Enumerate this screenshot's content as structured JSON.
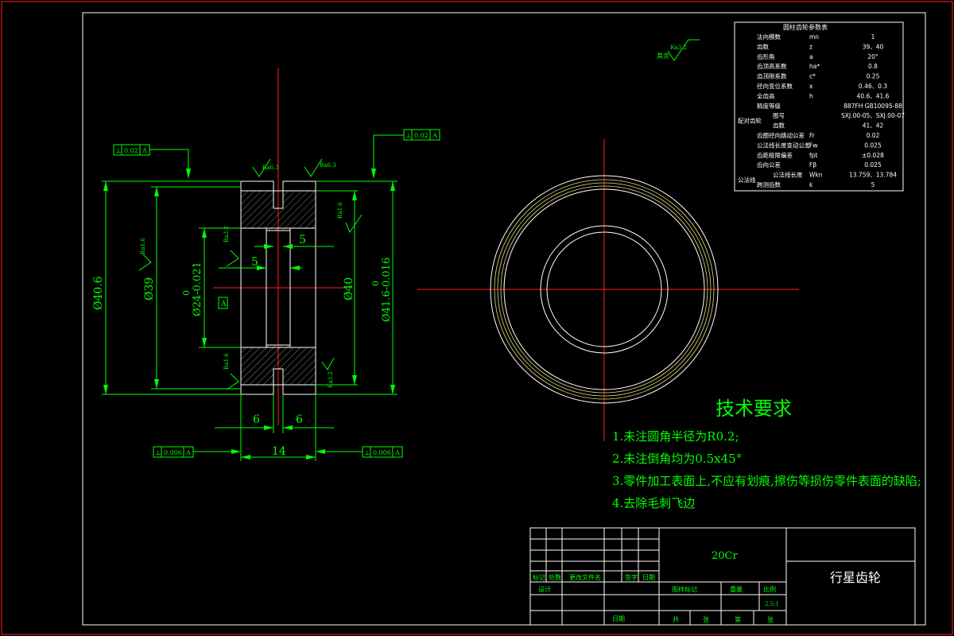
{
  "gear_params": {
    "title": "圆柱齿轮参数表",
    "rows": [
      {
        "name": "法向模数",
        "sym": "mn",
        "val": "1"
      },
      {
        "name": "齿数",
        "sym": "z",
        "val": "39、40"
      },
      {
        "name": "齿形角",
        "sym": "a",
        "val": "20°"
      },
      {
        "name": "齿顶高系数",
        "sym": "ha*",
        "val": "0.8"
      },
      {
        "name": "齿顶隙系数",
        "sym": "c*",
        "val": "0.25"
      },
      {
        "name": "径向变位系数",
        "sym": "x",
        "val": "0.46、0.3"
      },
      {
        "name": "全齿高",
        "sym": "h",
        "val": "40.6、41.6"
      },
      {
        "name": "精度等级",
        "sym": "",
        "val": "887FH GB10095-88"
      },
      {
        "name": "图号",
        "sym": "",
        "val": "SXJ.00-05、SXJ.00-07"
      },
      {
        "name": "齿数",
        "sym": "",
        "val": "41、42"
      },
      {
        "name": "齿圈径向跳动公差",
        "sym": "Fr",
        "val": "0.02"
      },
      {
        "name": "公法线长度变动公差",
        "sym": "Fw",
        "val": "0.025"
      },
      {
        "name": "齿距极限偏差",
        "sym": "fpt",
        "val": "±0.028"
      },
      {
        "name": "齿向公差",
        "sym": "Fβ",
        "val": "0.025"
      },
      {
        "name": "公法线长度",
        "sym": "Wkn",
        "val": "13.759、13.784"
      },
      {
        "name": "跨测齿数",
        "sym": "k",
        "val": "5"
      }
    ],
    "mating_label": "配对齿轮",
    "common_normal_label": "公法线"
  },
  "dims": {
    "d1": "Ø40.6",
    "d2": "Ø39",
    "d3": "Ø24-0.021",
    "d3_sup": "0",
    "d4": "Ø40",
    "d5": "Ø41.6-0.016",
    "d5_sup": "0",
    "w5a": "5",
    "w5b": "5",
    "w6a": "6",
    "w6b": "6",
    "w14": "14",
    "datum": "A"
  },
  "roughness": {
    "main": "Ra3.2",
    "r1": "Ra6.3",
    "r2": "Ra6.3",
    "r3": "Ra1.6",
    "r4": "Ra1.6",
    "r5": "Ra3.2",
    "r6": "Ra1.6",
    "r7": "Ra3.2",
    "r8": "Ra3.2",
    "rest_label": "其余"
  },
  "tolerances": {
    "t1": "0.02",
    "t2": "0.02",
    "t3": "0.006",
    "t4": "0.006",
    "ref": "A"
  },
  "tech": {
    "heading": "技术要求",
    "items": [
      "1.未注圆角半径为R0.2;",
      "2.未注倒角均为0.5x45°",
      "3.零件加工表面上,不应有划痕,擦伤等损伤零件表面的缺陷;",
      "4.去除毛刺飞边"
    ]
  },
  "title_block": {
    "material": "20Cr",
    "part_name": "行星齿轮",
    "headers": [
      "标记",
      "处数",
      "更改文件名",
      "签字",
      "日期"
    ],
    "design": "设计",
    "date": "日期",
    "stage": "图样标记",
    "weight": "重量",
    "scale": "比例",
    "scale_value": "2.5:1",
    "sheet_a": "共",
    "sheet_b": "张",
    "sheet_c": "第",
    "sheet_d": "张"
  }
}
